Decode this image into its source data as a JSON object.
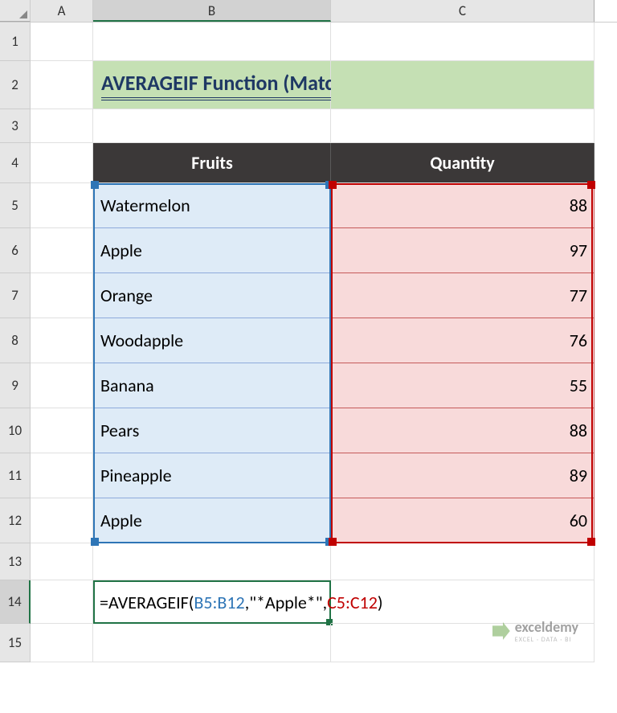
{
  "columns": [
    "A",
    "B",
    "C"
  ],
  "rows": [
    "1",
    "2",
    "3",
    "4",
    "5",
    "6",
    "7",
    "8",
    "9",
    "10",
    "11",
    "12",
    "13",
    "14",
    "15"
  ],
  "title": "AVERAGEIF Function (Match in String)",
  "headers": {
    "fruits": "Fruits",
    "quantity": "Quantity"
  },
  "chart_data": {
    "type": "table",
    "columns": [
      "Fruits",
      "Quantity"
    ],
    "rows": [
      {
        "fruit": "Watermelon",
        "qty": 88
      },
      {
        "fruit": "Apple",
        "qty": 97
      },
      {
        "fruit": "Orange",
        "qty": 77
      },
      {
        "fruit": "Woodapple",
        "qty": 76
      },
      {
        "fruit": "Banana",
        "qty": 55
      },
      {
        "fruit": "Pears",
        "qty": 88
      },
      {
        "fruit": "Pineapple",
        "qty": 89
      },
      {
        "fruit": "Apple",
        "qty": 60
      }
    ]
  },
  "formula": {
    "prefix": "=AVERAGEIF(",
    "range1": "B5:B12",
    "mid": ",\"*Apple*\",",
    "range2": "C5:C12",
    "suffix": ")"
  },
  "watermark": {
    "name": "exceldemy",
    "tagline": "EXCEL · DATA · BI"
  }
}
